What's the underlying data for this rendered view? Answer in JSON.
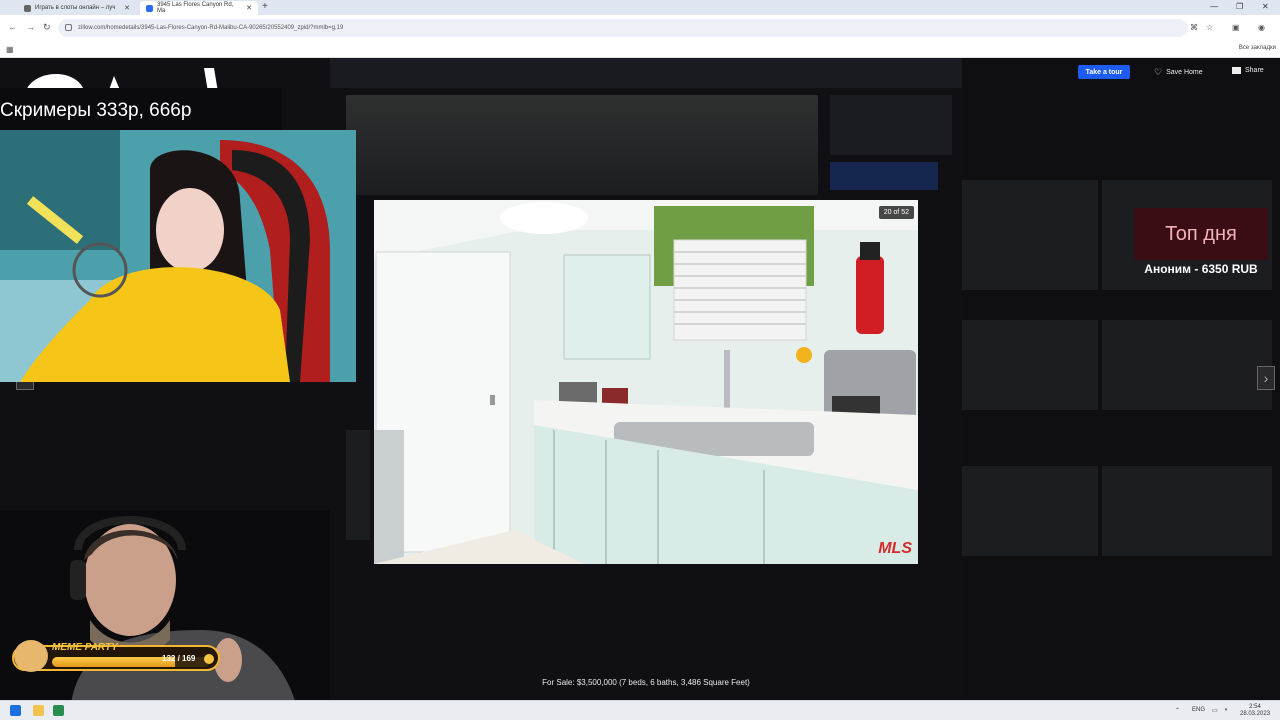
{
  "browser": {
    "tabs": [
      {
        "label": "Играть в слоты онлайн – луч"
      },
      {
        "label": "3945 Las Flores Canyon Rd, Ma"
      }
    ],
    "new_tab": "+",
    "url": "zillow.com/homedetails/3945-Las-Flores-Canyon-Rd-Malibu-CA-90265/20552409_zpid/?mmlb=g,19",
    "bookmarks_all": "Все закладки"
  },
  "zillow": {
    "take_tour": "Take a tour",
    "save_home": "Save Home",
    "share": "Share",
    "photo_counter": "20 of 52",
    "mls_logo": "MLS",
    "caption": "For Sale: $3,500,000 (7 beds, 6 baths, 3,486 Square Feet)"
  },
  "stream": {
    "screamers": "Скримеры 333р, 666р",
    "top_day": "Топ дня",
    "top_donor": "Аноним - 6350 RUB",
    "meme_party": {
      "label": "MEME PARTY",
      "count": "132 / 169",
      "progress": 0.781
    }
  },
  "taskbar": {
    "lang": "ENG",
    "time": "2:54",
    "date": "28.03.2023"
  },
  "colors": {
    "zillow_blue": "#1d5cf0",
    "overlay_dark": "#101014",
    "top_day_bg": "#3a0c14",
    "meme_gold": "#f2b633"
  },
  "icons": [
    "back-icon",
    "forward-icon",
    "reload-icon",
    "lock-icon",
    "translate-icon",
    "star-icon",
    "extensions-icon",
    "profile-icon",
    "heart-icon",
    "mail-icon",
    "chevron-left-icon",
    "chevron-right-icon",
    "windows-start-icon"
  ]
}
